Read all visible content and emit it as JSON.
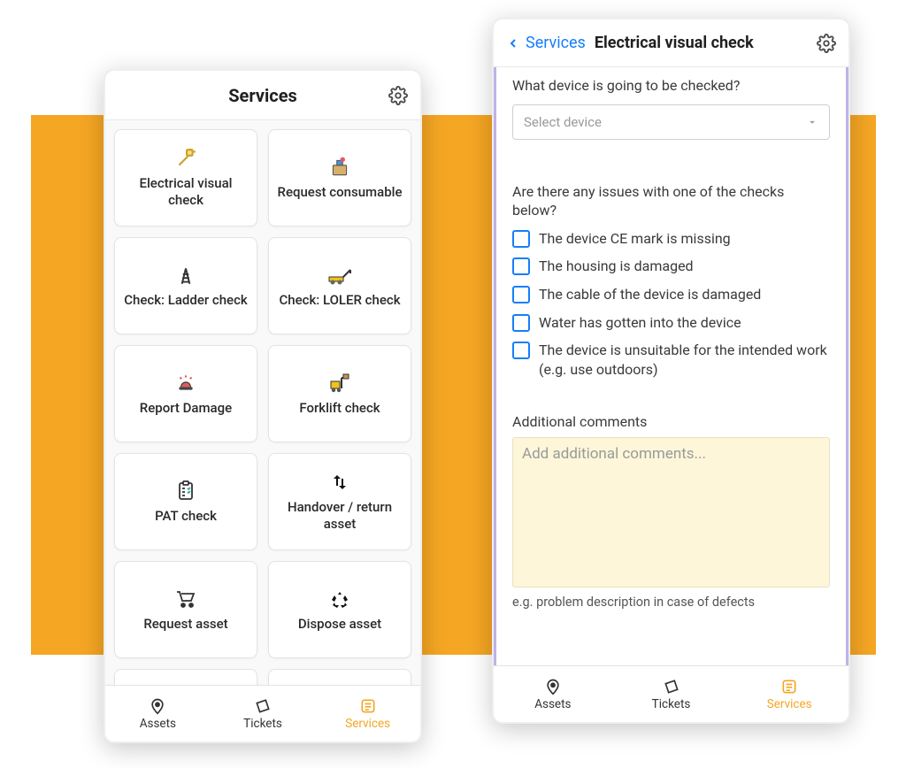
{
  "phone1": {
    "title": "Services",
    "cards": [
      {
        "label": "Electrical visual check",
        "icon": "plug-icon"
      },
      {
        "label": "Request consumable",
        "icon": "box-icon"
      },
      {
        "label": "Check: Ladder check",
        "icon": "ladder-icon"
      },
      {
        "label": "Check: LOLER check",
        "icon": "crane-icon"
      },
      {
        "label": "Report Damage",
        "icon": "alarm-icon"
      },
      {
        "label": "Forklift check",
        "icon": "forklift-icon"
      },
      {
        "label": "PAT check",
        "icon": "clipboard-icon"
      },
      {
        "label": "Handover / return asset",
        "icon": "transfer-icon"
      },
      {
        "label": "Request asset",
        "icon": "cart-icon"
      },
      {
        "label": "Dispose asset",
        "icon": "recycle-icon"
      }
    ],
    "nav": {
      "assets": "Assets",
      "tickets": "Tickets",
      "services": "Services"
    }
  },
  "phone2": {
    "back_crumb": "Services",
    "title": "Electrical visual check",
    "q_device": "What device is going to be checked?",
    "device_placeholder": "Select device",
    "q_issues": "Are there any issues with one of the checks below?",
    "checks": [
      "The device CE mark is missing",
      "The housing is damaged",
      "The cable of the device is damaged",
      "Water has gotten into the device",
      "The device is unsuitable for the intended work (e.g. use outdoors)"
    ],
    "comments_label": "Additional comments",
    "comments_placeholder": "Add additional comments...",
    "comments_hint": "e.g. problem description in case of defects",
    "nav": {
      "assets": "Assets",
      "tickets": "Tickets",
      "services": "Services"
    }
  }
}
